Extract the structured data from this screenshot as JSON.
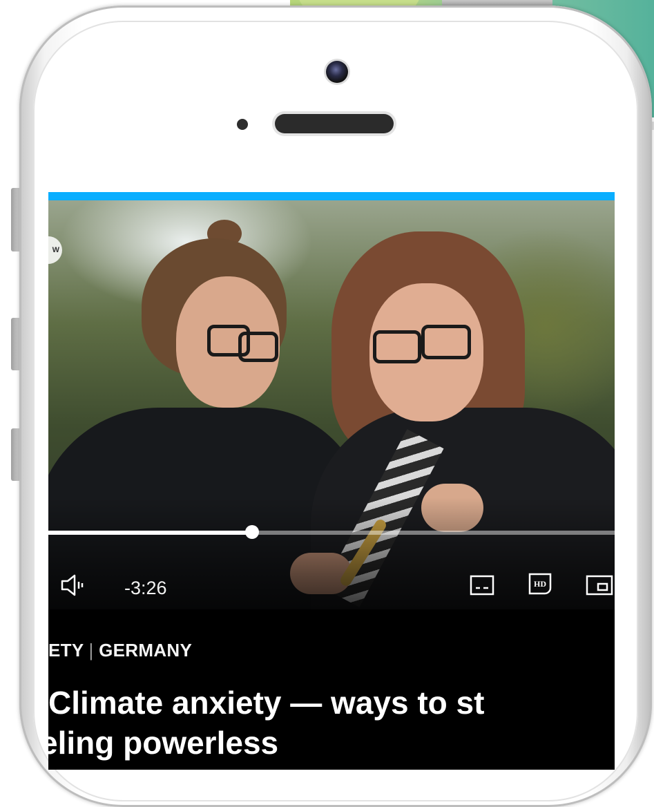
{
  "player": {
    "time_remaining": "-3:26",
    "progress_fraction": 0.36,
    "accent_color": "#0aaeff",
    "icons": [
      "volume-icon",
      "subtitles-icon",
      "hd-icon",
      "picture-in-picture-icon"
    ]
  },
  "article": {
    "category_left": "ETY",
    "category_separator": "|",
    "category_right": "GERMANY",
    "headline_line1": "Climate anxiety — ways to st",
    "headline_line2": "eling powerless"
  },
  "brand": {
    "logo_text": "W"
  }
}
